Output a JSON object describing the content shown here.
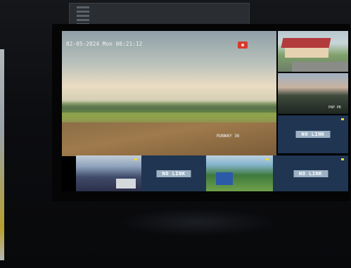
{
  "monitor": {
    "datetime_overlay": "02-05-2024 Mon 06:21:12",
    "rec_icon": "recording-icon",
    "main_label": "RUNWAY 36",
    "sunset_label": "PAP PK",
    "no_link_text": "NO LINK"
  },
  "colors": {
    "no_link_bg": "#1f3552",
    "rec": "#d83a2c"
  }
}
